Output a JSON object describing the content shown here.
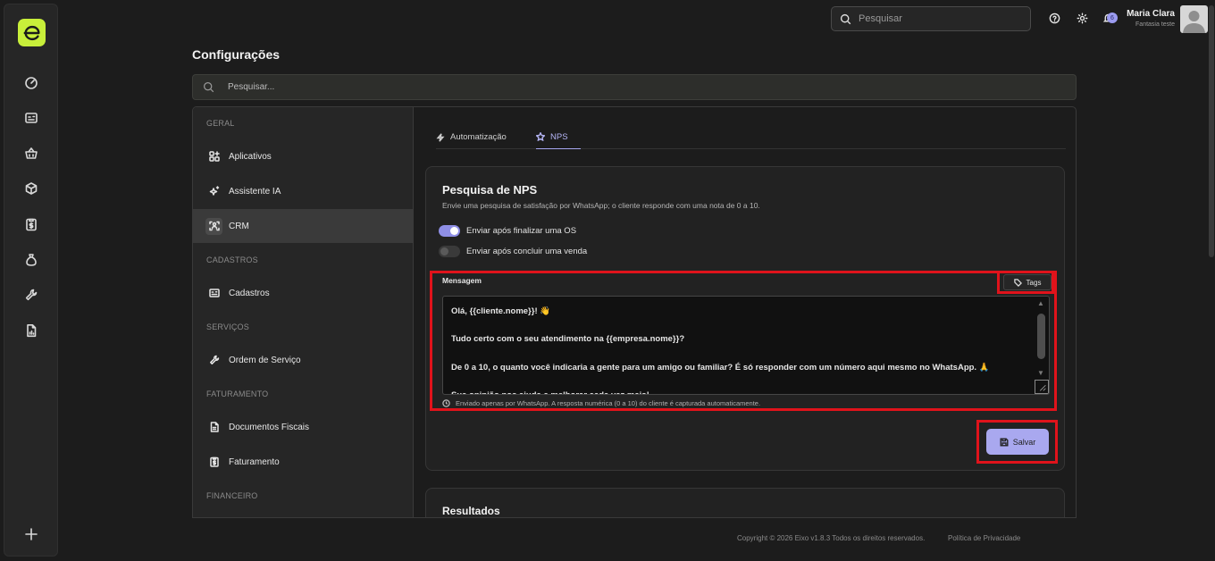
{
  "topbar": {
    "search_placeholder": "Pesquisar",
    "notification_count": "6",
    "user_name": "Maria Clara",
    "user_company": "Fantasia teste"
  },
  "page": {
    "title": "Configurações",
    "search_placeholder": "Pesquisar..."
  },
  "settings_nav": {
    "sections": [
      {
        "label": "GERAL",
        "items": [
          "Aplicativos",
          "Assistente IA",
          "CRM"
        ]
      },
      {
        "label": "CADASTROS",
        "items": [
          "Cadastros"
        ]
      },
      {
        "label": "SERVIÇOS",
        "items": [
          "Ordem de Serviço"
        ]
      },
      {
        "label": "FATURAMENTO",
        "items": [
          "Documentos Fiscais",
          "Faturamento"
        ]
      },
      {
        "label": "FINANCEIRO",
        "items": []
      }
    ],
    "active_item": "CRM"
  },
  "tabs": [
    {
      "label": "Automatização",
      "icon": "bolt-icon",
      "active": false
    },
    {
      "label": "NPS",
      "icon": "star-icon",
      "active": true
    }
  ],
  "nps_card": {
    "title": "Pesquisa de NPS",
    "description": "Envie uma pesquisa de satisfação por WhatsApp; o cliente responde com uma nota de 0 a 10.",
    "toggles": [
      {
        "label": "Enviar após finalizar uma OS",
        "on": true
      },
      {
        "label": "Enviar após concluir uma venda",
        "on": false
      }
    ],
    "message_label": "Mensagem",
    "tags_label": "Tags",
    "message_value": "Olá, {{cliente.nome}}! 👋\n\nTudo certo com o seu atendimento na {{empresa.nome}}?\n\nDe 0 a 10, o quanto você indicaria a gente para um amigo ou familiar? É só responder com um número aqui mesmo no WhatsApp. 🙏\n\nSua opinião nos ajuda a melhorar cada vez mais!",
    "hint": "Enviado apenas por WhatsApp. A resposta numérica (0 a 10) do cliente é capturada automaticamente.",
    "save_label": "Salvar"
  },
  "results_card": {
    "title": "Resultados"
  },
  "footer": {
    "copyright": "Copyright © 2026 Eixo v1.8.3 Todos os direitos reservados.",
    "privacy": "Política de Privacidade"
  },
  "colors": {
    "accent": "#a9a8ef",
    "brand_logo": "#c8ef3a",
    "highlight": "#e0131b"
  }
}
